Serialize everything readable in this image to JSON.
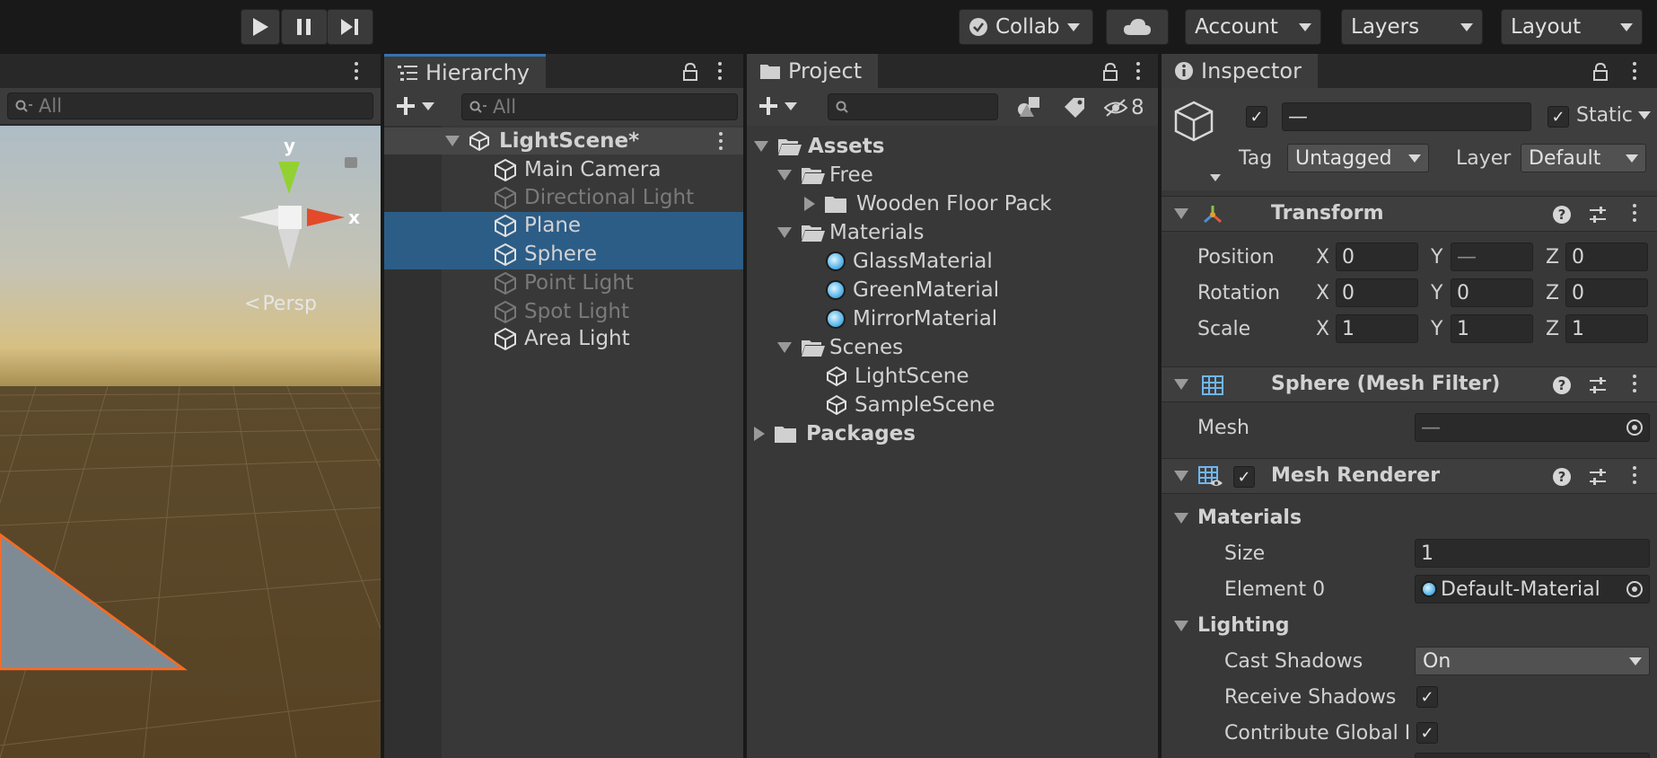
{
  "toolbar": {
    "play_buttons": [
      "play-icon",
      "pause-icon",
      "step-icon"
    ],
    "collab_label": "Collab",
    "account_label": "Account",
    "layers_label": "Layers",
    "layout_label": "Layout"
  },
  "scene": {
    "search_placeholder": "All",
    "gizmo_y": "y",
    "gizmo_x": "x",
    "persp_label": "Persp"
  },
  "hierarchy": {
    "tab_label": "Hierarchy",
    "search_placeholder": "All",
    "scene_name": "LightScene*",
    "items": [
      {
        "label": "Main Camera",
        "state": "normal"
      },
      {
        "label": "Directional Light",
        "state": "disabled"
      },
      {
        "label": "Plane",
        "state": "selected"
      },
      {
        "label": "Sphere",
        "state": "selected"
      },
      {
        "label": "Point Light",
        "state": "disabled"
      },
      {
        "label": "Spot Light",
        "state": "disabled"
      },
      {
        "label": "Area Light",
        "state": "normal"
      }
    ]
  },
  "project": {
    "tab_label": "Project",
    "hidden_count": "8",
    "tree": {
      "assets": "Assets",
      "free": "Free",
      "wooden_floor_pack": "Wooden Floor Pack",
      "materials": "Materials",
      "glass_material": "GlassMaterial",
      "green_material": "GreenMaterial",
      "mirror_material": "MirrorMaterial",
      "scenes": "Scenes",
      "light_scene": "LightScene",
      "sample_scene": "SampleScene",
      "packages": "Packages"
    }
  },
  "inspector": {
    "tab_label": "Inspector",
    "object_name": "—",
    "static_label": "Static",
    "tag_label": "Tag",
    "tag_value": "Untagged",
    "layer_label": "Layer",
    "layer_value": "Default",
    "transform": {
      "title": "Transform",
      "position_label": "Position",
      "rotation_label": "Rotation",
      "scale_label": "Scale",
      "axis_x": "X",
      "axis_y": "Y",
      "axis_z": "Z",
      "position": {
        "x": "0",
        "y": "—",
        "z": "0"
      },
      "rotation": {
        "x": "0",
        "y": "0",
        "z": "0"
      },
      "scale": {
        "x": "1",
        "y": "1",
        "z": "1"
      }
    },
    "mesh_filter": {
      "title": "Sphere (Mesh Filter)",
      "mesh_label": "Mesh",
      "mesh_value": "—"
    },
    "mesh_renderer": {
      "title": "Mesh Renderer",
      "materials_label": "Materials",
      "size_label": "Size",
      "size_value": "1",
      "element0_label": "Element 0",
      "element0_value": "Default-Material",
      "lighting_label": "Lighting",
      "cast_shadows_label": "Cast Shadows",
      "cast_shadows_value": "On",
      "receive_shadows_label": "Receive Shadows",
      "contribute_gi_label": "Contribute Global I"
    }
  },
  "colors": {
    "selection": "#2c5d87",
    "accent_blue": "#3a72b0",
    "panel_bg": "#383838"
  }
}
